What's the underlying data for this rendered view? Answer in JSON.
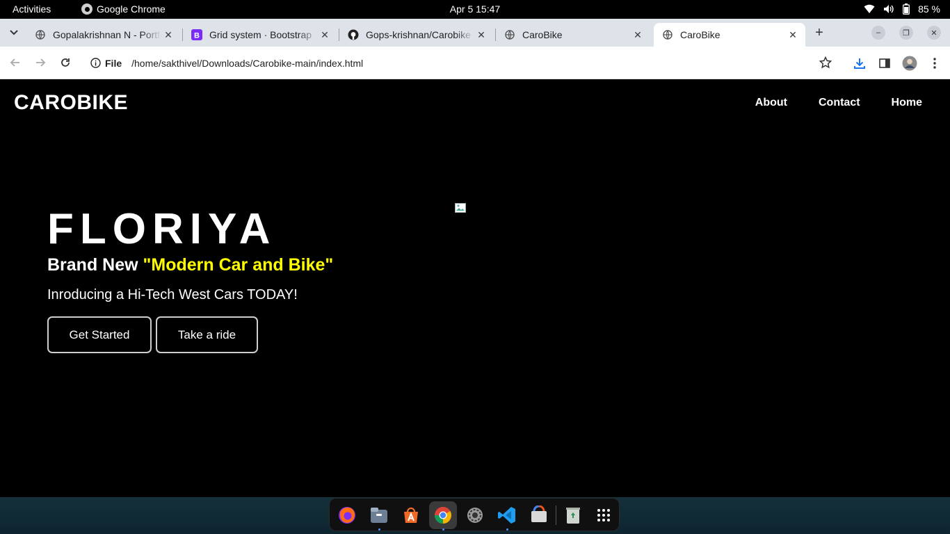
{
  "system": {
    "activities": "Activities",
    "app_name": "Google Chrome",
    "clock": "Apr 5  15:47",
    "battery": "85 %"
  },
  "tabs": [
    {
      "title": "Gopalakrishnan N - Portfolio",
      "favicon": "globe-icon",
      "active": false
    },
    {
      "title": "Grid system · Bootstrap",
      "favicon": "bootstrap-icon",
      "active": false
    },
    {
      "title": "Gops-krishnan/Carobike",
      "favicon": "github-icon",
      "active": false
    },
    {
      "title": "CaroBike",
      "favicon": "globe-icon",
      "active": false
    },
    {
      "title": "CaroBike",
      "favicon": "globe-icon",
      "active": true
    }
  ],
  "addressbar": {
    "scheme_label": "File",
    "url": "/home/sakthivel/Downloads/Carobike-main/index.html"
  },
  "page": {
    "brand": "CAROBIKE",
    "nav": [
      "About",
      "Contact",
      "Home"
    ],
    "hero_title": "FLORIYA",
    "hero_sub_prefix": "Brand New ",
    "hero_sub_highlight": "\"Modern Car and Bike\"",
    "hero_text": "Inroducing a Hi-Tech West Cars TODAY!",
    "buttons": [
      "Get Started",
      "Take a ride"
    ],
    "highlight_color": "#ffff00"
  },
  "dock": [
    "firefox-icon",
    "files-icon",
    "app-center-icon",
    "chrome-icon",
    "settings-icon",
    "vscode-icon",
    "software-updater-icon",
    "trash-icon",
    "app-grid-icon"
  ]
}
